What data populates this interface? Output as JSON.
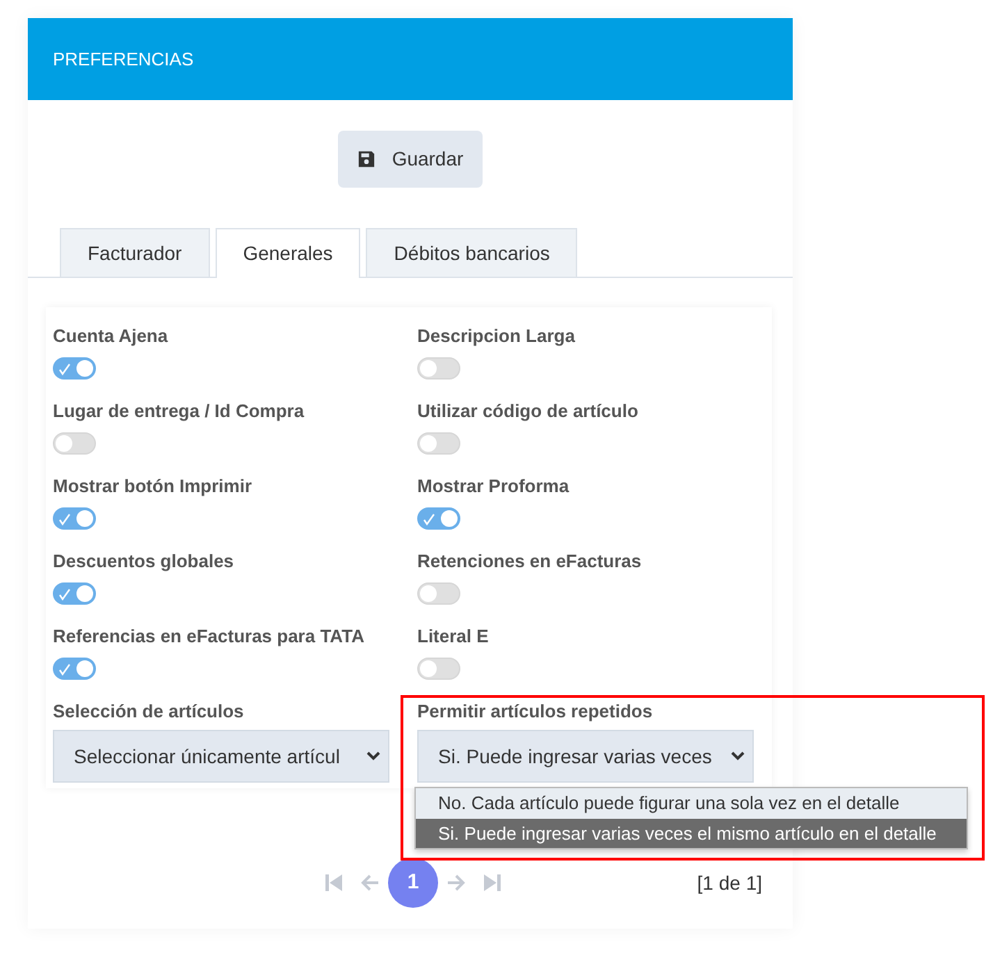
{
  "header": {
    "title": "PREFERENCIAS"
  },
  "save_button": {
    "label": "Guardar"
  },
  "tabs": [
    {
      "label": "Facturador",
      "selected": false
    },
    {
      "label": "Generales",
      "selected": true
    },
    {
      "label": "Débitos bancarios",
      "selected": false
    }
  ],
  "switches": [
    {
      "label": "Cuenta Ajena",
      "on": true
    },
    {
      "label": "Descripcion Larga",
      "on": false
    },
    {
      "label": "Lugar de entrega / Id Compra",
      "on": false
    },
    {
      "label": "Utilizar código de artículo",
      "on": false
    },
    {
      "label": "Mostrar botón Imprimir",
      "on": true
    },
    {
      "label": "Mostrar Proforma",
      "on": true
    },
    {
      "label": "Descuentos globales",
      "on": true
    },
    {
      "label": "Retenciones en eFacturas",
      "on": false
    },
    {
      "label": "Referencias en eFacturas para TATA",
      "on": true
    },
    {
      "label": "Literal E",
      "on": false
    }
  ],
  "selects": [
    {
      "label": "Selección de artículos",
      "value": "Seleccionar únicamente artícul"
    },
    {
      "label": "Permitir artículos repetidos",
      "value": "Si. Puede ingresar varias veces",
      "highlighted": true,
      "options": [
        {
          "label": "No. Cada artículo puede figurar una sola vez en el detalle",
          "selected": false
        },
        {
          "label": "Si. Puede ingresar varias veces el mismo artículo en el detalle",
          "selected": true
        }
      ]
    }
  ],
  "pagination": {
    "pages": [
      {
        "label": "1",
        "selected": true
      }
    ],
    "summary": "[1 de 1]"
  }
}
